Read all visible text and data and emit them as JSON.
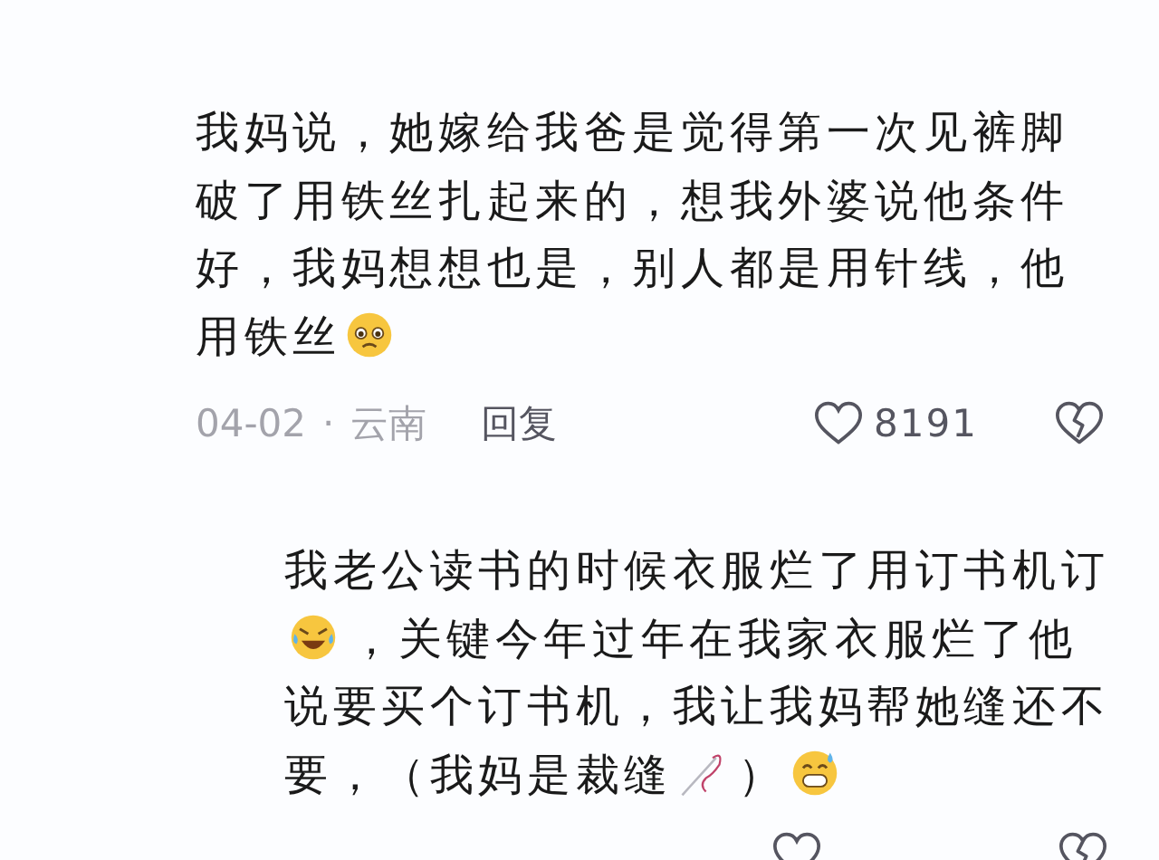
{
  "comments": [
    {
      "body": [
        {
          "kind": "text",
          "text": "我妈说，她嫁给我爸是觉得第一次见裤脚破了用铁丝扎起来的，想我外婆说他条件好，我妈想想也是，别人都是用针线，他用铁丝"
        },
        {
          "kind": "pleading"
        }
      ],
      "date": "04-02",
      "separator": "·",
      "location": "云南",
      "reply": "回复",
      "likes": "8191"
    },
    {
      "body": [
        {
          "kind": "text",
          "text": "我老公读书的时候衣服烂了用订书机订"
        },
        {
          "kind": "rofl"
        },
        {
          "kind": "text",
          "text": "，关键今年过年在我家衣服烂了他说要买个订书机，我让我妈帮她缝还不要，（我妈是裁缝"
        },
        {
          "kind": "needle"
        },
        {
          "kind": "text",
          "text": "）"
        },
        {
          "kind": "sweat"
        }
      ]
    }
  ]
}
